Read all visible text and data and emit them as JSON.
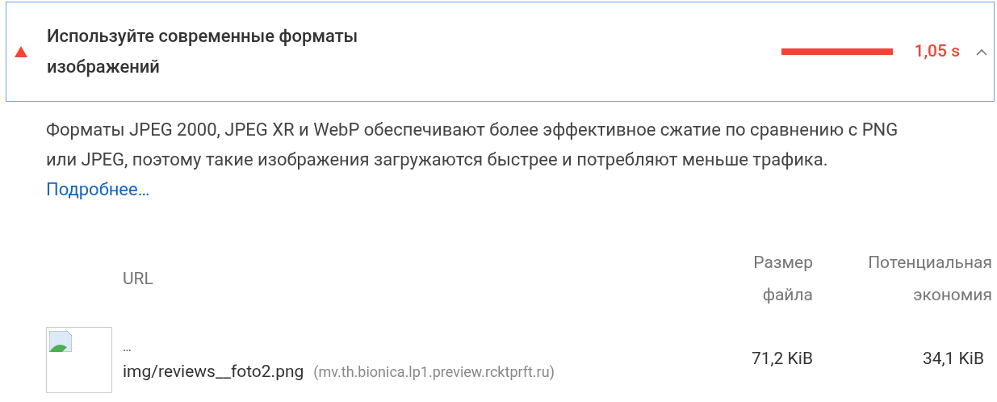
{
  "audit": {
    "title": "Используйте современные форматы изображений",
    "failed": true,
    "time": "1,05 s",
    "expanded": true
  },
  "description": {
    "text": "Форматы JPEG 2000, JPEG XR и WebP обеспечивают более эффективное сжатие по сравнению с PNG или JPEG, поэтому такие изображения загружаются быстрее и потребляют меньше трафика.",
    "link": "Подробнее…"
  },
  "table": {
    "columns": [
      "URL",
      "Размер файла",
      "Потенциальная экономия"
    ],
    "rows": [
      {
        "url_prefix": "…",
        "url": "img/reviews__foto2.png",
        "host": "(mv.th.bionica.lp1.preview.rcktprft.ru)",
        "size": "71,2 KiB",
        "savings": "34,1 KiB"
      }
    ]
  }
}
